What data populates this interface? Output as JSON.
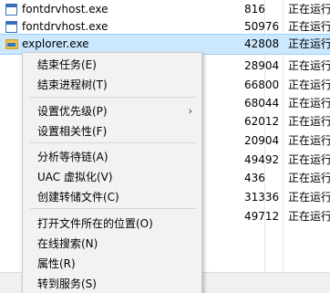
{
  "processes": [
    {
      "icon": "app-window-icon",
      "name": "fontdrvhost.exe",
      "pid": "816",
      "status": "正在运行"
    },
    {
      "icon": "app-window-icon",
      "name": "fontdrvhost.exe",
      "pid": "50976",
      "status": "正在运行"
    },
    {
      "icon": "folder-icon",
      "name": "explorer.exe",
      "pid": "42808",
      "status": "正在运行",
      "selected": true
    },
    {
      "icon": "",
      "name": "",
      "pid": "28904",
      "status": "正在运行"
    },
    {
      "icon": "",
      "name": "",
      "pid": "66800",
      "status": "正在运行"
    },
    {
      "icon": "",
      "name": "",
      "pid": "68044",
      "status": "正在运行"
    },
    {
      "icon": "",
      "name": "",
      "pid": "62012",
      "status": "正在运行"
    },
    {
      "icon": "",
      "name": "",
      "pid": "20904",
      "status": "正在运行"
    },
    {
      "icon": "",
      "name": "",
      "pid": "49492",
      "status": "正在运行"
    },
    {
      "icon": "",
      "name": "",
      "pid": "436",
      "status": "正在运行"
    },
    {
      "icon": "",
      "name": "",
      "pid": "31336",
      "status": "正在运行"
    },
    {
      "icon": "",
      "name": "",
      "pid": "49712",
      "status": "正在运行"
    }
  ],
  "context_menu": {
    "items": [
      {
        "label": "结束任务(E)"
      },
      {
        "label": "结束进程树(T)"
      },
      {
        "label": "设置优先级(P)",
        "submenu": true
      },
      {
        "label": "设置相关性(F)"
      },
      {
        "label": "分析等待链(A)"
      },
      {
        "label": "UAC 虚拟化(V)"
      },
      {
        "label": "创建转储文件(C)"
      },
      {
        "label": "打开文件所在的位置(O)"
      },
      {
        "label": "在线搜索(N)"
      },
      {
        "label": "属性(R)"
      },
      {
        "label": "转到服务(S)"
      }
    ],
    "submenu_arrow": "›"
  },
  "colors": {
    "selected_row": "#cce8ff",
    "menu_background": "#f2f2f2"
  }
}
